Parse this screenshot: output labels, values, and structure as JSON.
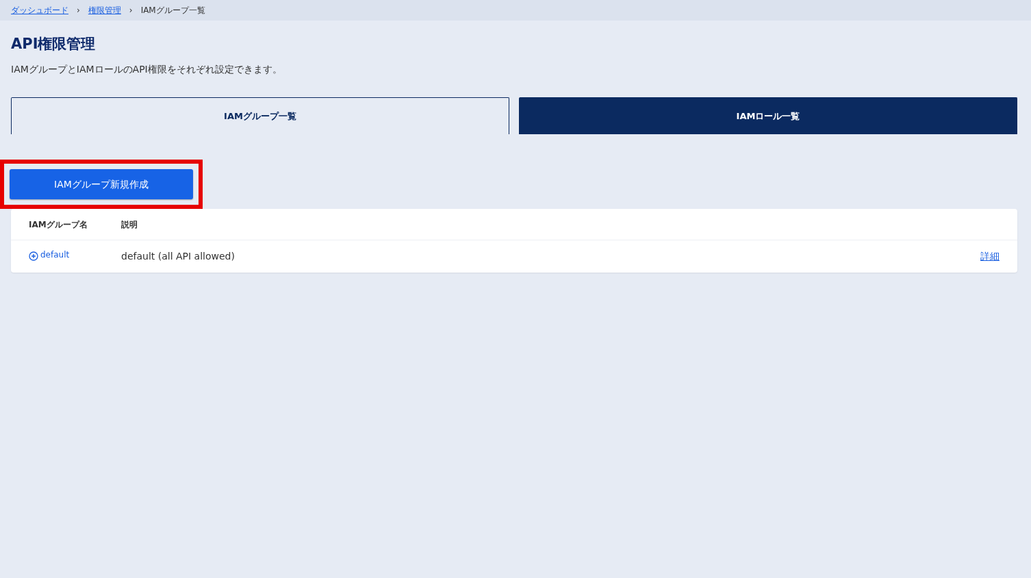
{
  "breadcrumb": [
    {
      "label": "ダッシュボード",
      "link": true
    },
    {
      "label": "権限管理",
      "link": true
    },
    {
      "label": "IAMグループ一覧",
      "link": false
    }
  ],
  "breadcrumb_separator": "›",
  "title": "API権限管理",
  "description": "IAMグループとIAMロールのAPI権限をそれぞれ設定できます。",
  "tabs": [
    {
      "label": "IAMグループ一覧",
      "selected": true
    },
    {
      "label": "IAMロール一覧",
      "selected": false
    }
  ],
  "create_button": {
    "label": "IAMグループ新規作成",
    "highlighted": true
  },
  "table": {
    "columns": [
      "IAMグループ名",
      "説明"
    ],
    "rows": [
      {
        "name": "default",
        "description": "default (all API allowed)",
        "action": "詳細"
      }
    ]
  }
}
